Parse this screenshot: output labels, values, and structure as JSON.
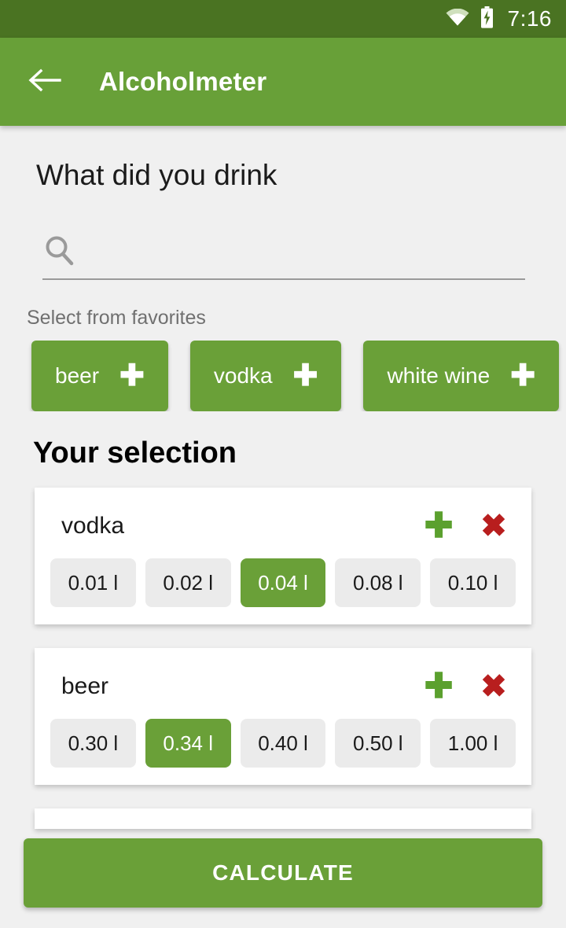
{
  "status_bar": {
    "time": "7:16",
    "wifi_icon": "wifi-icon",
    "battery_icon": "battery-charging-icon",
    "background_color": "#4a7322"
  },
  "toolbar": {
    "title": "Alcoholmeter",
    "back_icon": "arrow-left-icon",
    "background_color": "#68a038"
  },
  "page": {
    "heading": "What did you drink",
    "background_color": "#f0f0f0"
  },
  "search": {
    "icon": "search-icon",
    "value": "",
    "placeholder": ""
  },
  "favorites": {
    "label": "Select from favorites",
    "chips": [
      {
        "label": "beer",
        "add_icon": "plus-icon"
      },
      {
        "label": "vodka",
        "add_icon": "plus-icon"
      },
      {
        "label": "white wine",
        "add_icon": "plus-icon"
      }
    ]
  },
  "selection": {
    "heading": "Your selection",
    "add_icon": "plus-icon",
    "remove_icon": "close-x-icon",
    "accent_color": "#6aa038",
    "remove_color": "#b81e1e",
    "cards": [
      {
        "name": "vodka",
        "volumes": [
          {
            "label": "0.01 l",
            "selected": false
          },
          {
            "label": "0.02 l",
            "selected": false
          },
          {
            "label": "0.04 l",
            "selected": true
          },
          {
            "label": "0.08 l",
            "selected": false
          },
          {
            "label": "0.10 l",
            "selected": false
          }
        ]
      },
      {
        "name": "beer",
        "volumes": [
          {
            "label": "0.30 l",
            "selected": false
          },
          {
            "label": "0.34 l",
            "selected": false
          },
          {
            "label": "0.40 l",
            "selected": false
          },
          {
            "label": "0.50 l",
            "selected": false
          },
          {
            "label": "1.00 l",
            "selected": false
          }
        ]
      }
    ]
  },
  "footer": {
    "calculate_label": "CALCULATE"
  }
}
